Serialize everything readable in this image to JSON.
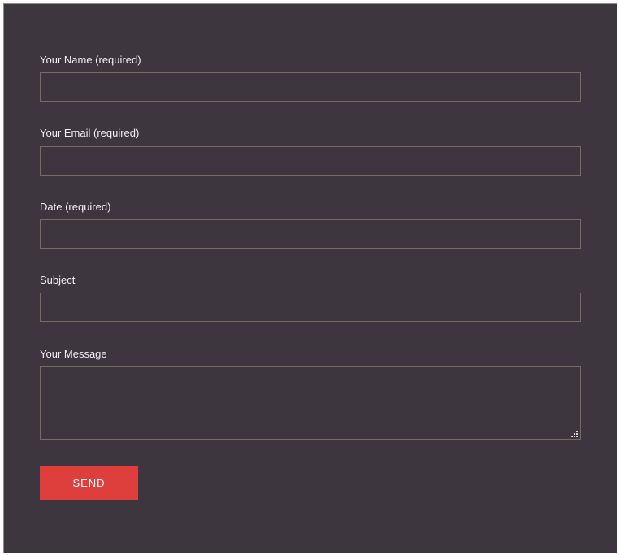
{
  "form": {
    "name": {
      "label": "Your Name (required)",
      "value": ""
    },
    "email": {
      "label": "Your Email (required)",
      "value": ""
    },
    "date": {
      "label": "Date (required)",
      "value": ""
    },
    "subject": {
      "label": "Subject",
      "value": ""
    },
    "message": {
      "label": "Your Message",
      "value": ""
    },
    "send_label": "SEND"
  },
  "colors": {
    "background": "#3e363e",
    "field_border": "#756e5d",
    "button": "#df3f3c",
    "text": "#f2eef2"
  }
}
